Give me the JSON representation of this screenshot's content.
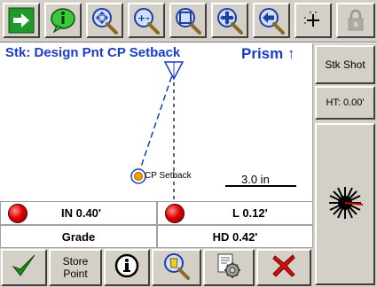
{
  "toolbar": {
    "buttons": [
      {
        "icon": "arrow-right-icon"
      },
      {
        "icon": "info-bubble-icon"
      },
      {
        "icon": "zoom-extents-icon"
      },
      {
        "icon": "zoom-out-icon"
      },
      {
        "icon": "zoom-window-icon"
      },
      {
        "icon": "pan-icon"
      },
      {
        "icon": "zoom-previous-icon"
      },
      {
        "icon": "target-plus-icon"
      },
      {
        "icon": "lock-icon"
      }
    ]
  },
  "map": {
    "title": "Stk: Design Pnt CP Setback",
    "prism_label": "Prism",
    "prism_arrow": "↑",
    "point_label": "CP Setback",
    "scale_label": "3.0 in"
  },
  "side_panel": {
    "stk_shot_label": "Stk Shot",
    "ht_label": "HT: 0.00'",
    "instrument_icon": "starburst-instrument-icon"
  },
  "status": {
    "in_value": "IN 0.40'",
    "l_value": "L 0.12'",
    "grade_label": "Grade",
    "hd_value": "HD 0.42'",
    "indicator_color": "#e00000"
  },
  "bottom_toolbar": {
    "accept_icon": "checkmark-icon",
    "store_point_line1": "Store",
    "store_point_line2": "Point",
    "info_icon": "info-circle-icon",
    "locate_icon": "zoom-locate-icon",
    "settings_icon": "settings-gear-icon",
    "cancel_icon": "red-x-icon"
  },
  "colors": {
    "accent_blue": "#1a3cc8",
    "toolbar_gray": "#d4d0c8",
    "confirm_green": "#1a8c1a",
    "cancel_red": "#d01010"
  }
}
